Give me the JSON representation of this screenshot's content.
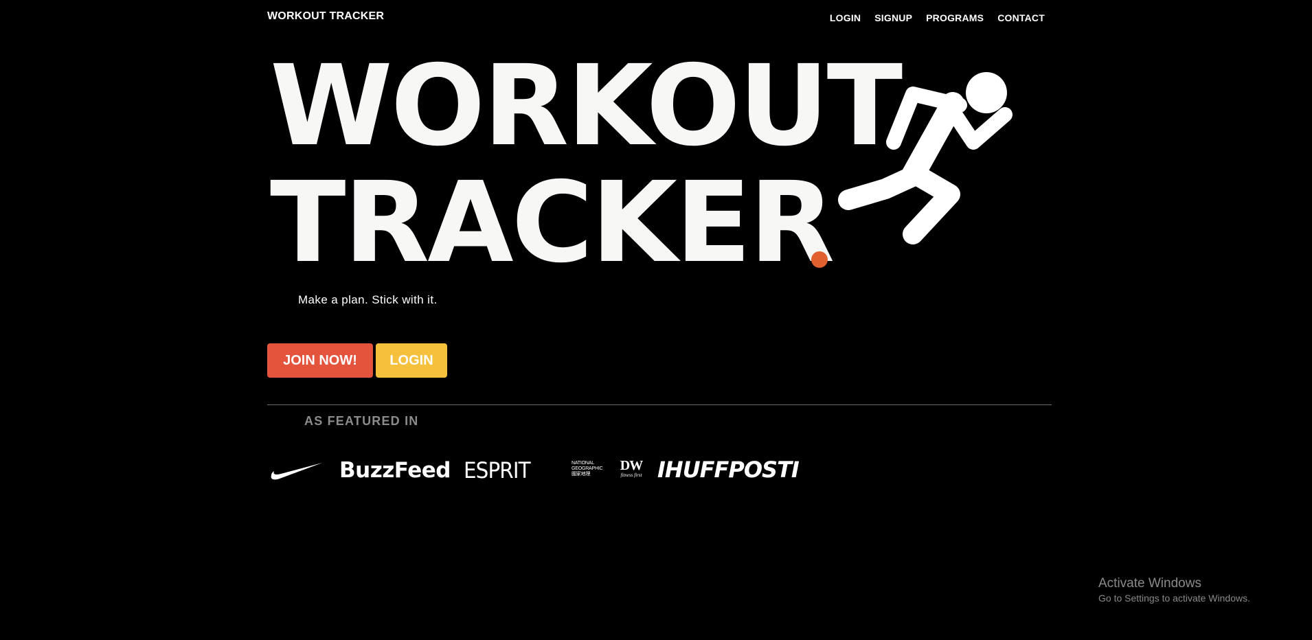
{
  "header": {
    "brand": "WORKOUT TRACKER",
    "nav": [
      {
        "label": "LOGIN"
      },
      {
        "label": "SIGNUP"
      },
      {
        "label": "PROGRAMS"
      },
      {
        "label": "CONTACT"
      }
    ]
  },
  "hero": {
    "title_line1": "WORKOUT",
    "title_line2": "TRACKER",
    "dot_color": "#e0612f",
    "tagline": "Make a plan. Stick with it.",
    "runner_icon": "running-person-icon"
  },
  "buttons": {
    "join_label": "JOIN NOW!",
    "join_color": "#e4533c",
    "login_label": "LOGIN",
    "login_color": "#f5c13c"
  },
  "featured": {
    "label": "AS FEATURED IN",
    "logos": [
      {
        "name": "nike-logo",
        "text": ""
      },
      {
        "name": "buzzfeed-logo",
        "text": "BuzzFeed"
      },
      {
        "name": "esprit-logo",
        "text": "ESPRIT"
      },
      {
        "name": "national-geographic-logo",
        "text": "NATIONAL GEOGRAPHIC 國家地理"
      },
      {
        "name": "dw-logo",
        "text": "DW",
        "subtext": "fitness first"
      },
      {
        "name": "huffpost-logo",
        "text": "IHUFFPOSTI"
      }
    ]
  },
  "os_watermark": {
    "title": "Activate Windows",
    "subtitle": "Go to Settings to activate Windows."
  }
}
